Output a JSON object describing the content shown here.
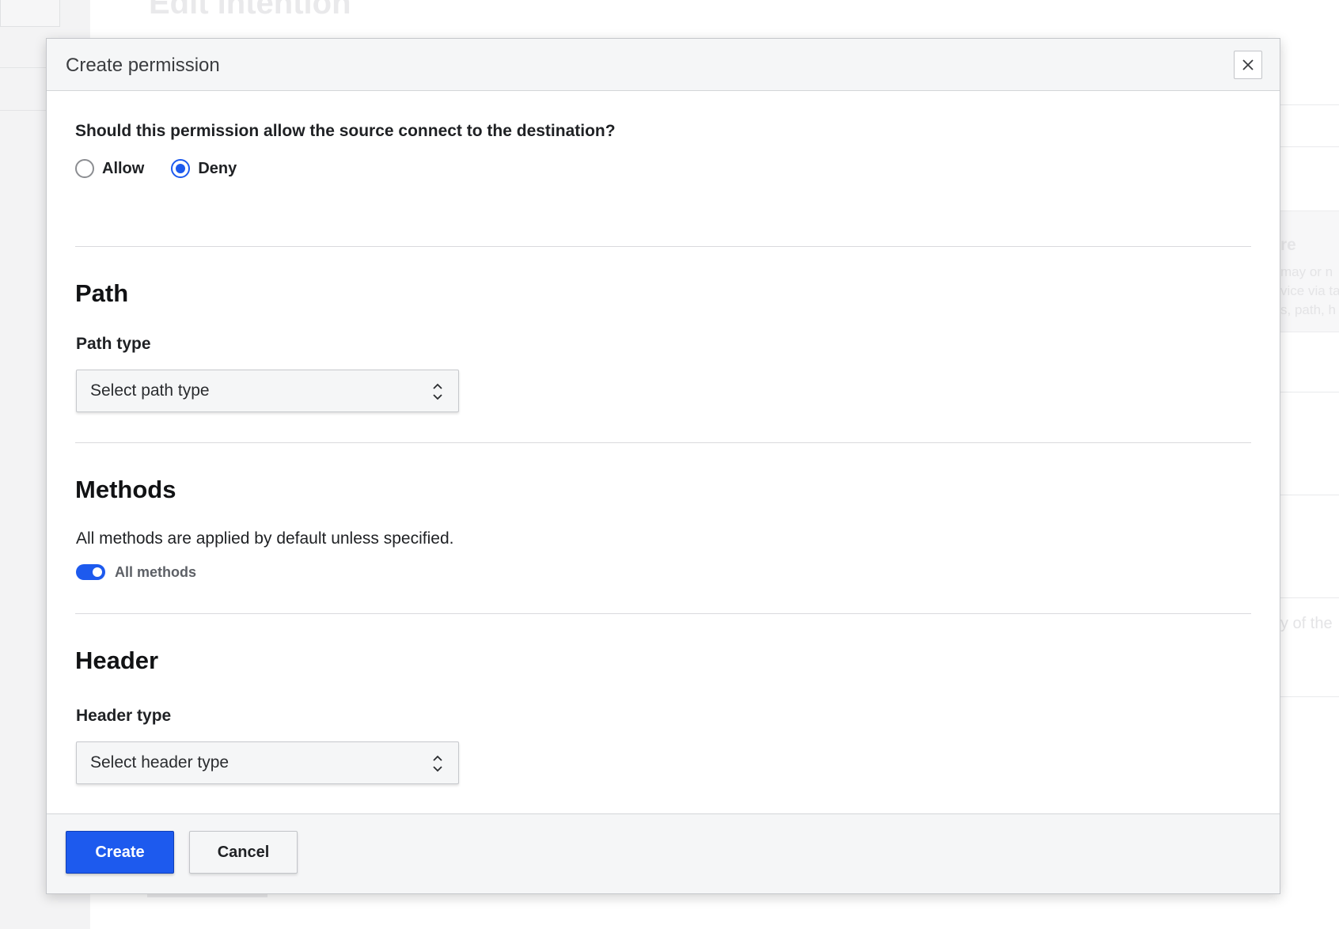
{
  "background": {
    "page_title": "Edit intention",
    "side_heading_fragment": "re",
    "side_text_fragments": [
      "may or n",
      "vice via ta",
      "s, path, h"
    ],
    "side_text_fragment_2": "y of the"
  },
  "modal": {
    "title": "Create permission",
    "close_icon": "close-icon",
    "question": "Should this permission allow the source connect to the destination?",
    "radio": {
      "options": [
        {
          "label": "Allow",
          "checked": false
        },
        {
          "label": "Deny",
          "checked": true
        }
      ]
    },
    "path": {
      "heading": "Path",
      "field_label": "Path type",
      "select_placeholder": "Select path type",
      "select_icon": "chevron-updown-icon"
    },
    "methods": {
      "heading": "Methods",
      "description": "All methods are applied by default unless specified.",
      "toggle_label": "All methods",
      "toggle_on": true
    },
    "header": {
      "heading": "Header",
      "field_label": "Header type",
      "select_placeholder": "Select header type",
      "select_icon": "chevron-updown-icon"
    },
    "footer": {
      "create_label": "Create",
      "cancel_label": "Cancel"
    }
  },
  "colors": {
    "accent": "#1d5aee",
    "header_bg": "#f5f6f7",
    "border": "#c5c7cb"
  }
}
